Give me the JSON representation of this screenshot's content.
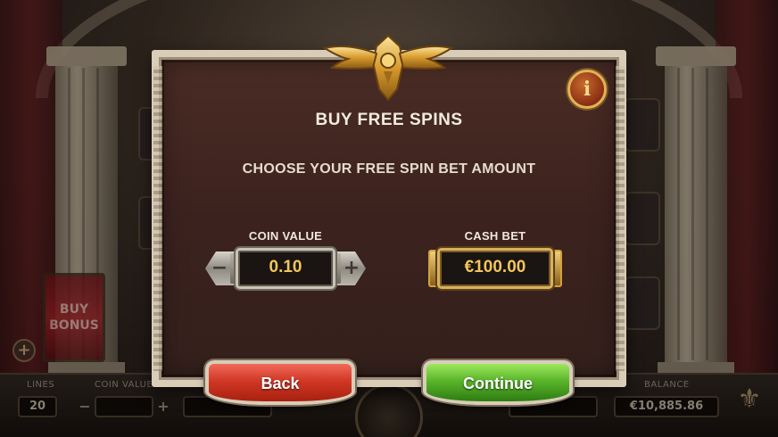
{
  "background": {
    "buy_bonus_label": "BUY\nBONUS",
    "bottom_bar": {
      "lines_label": "LINES",
      "lines_value": "20",
      "coin_value_label": "COIN VALUE",
      "balance_label": "BALANCE",
      "balance_value": "€10,885.86"
    }
  },
  "dialog": {
    "info_icon": "info-icon",
    "title": "BUY FREE SPINS",
    "subtitle": "CHOOSE YOUR FREE SPIN BET AMOUNT",
    "coin_value": {
      "label": "COIN VALUE",
      "value": "0.10",
      "minus_glyph": "−",
      "plus_glyph": "+"
    },
    "cash_bet": {
      "label": "CASH BET",
      "value": "€100.00"
    },
    "back_label": "Back",
    "continue_label": "Continue"
  },
  "colors": {
    "panel_bg": "#3c221e",
    "frame": "#d9cdb8",
    "value_text": "#f3c55c",
    "back_button": "#d23826",
    "continue_button": "#5ab52a",
    "gold_accent": "#e1b458"
  }
}
